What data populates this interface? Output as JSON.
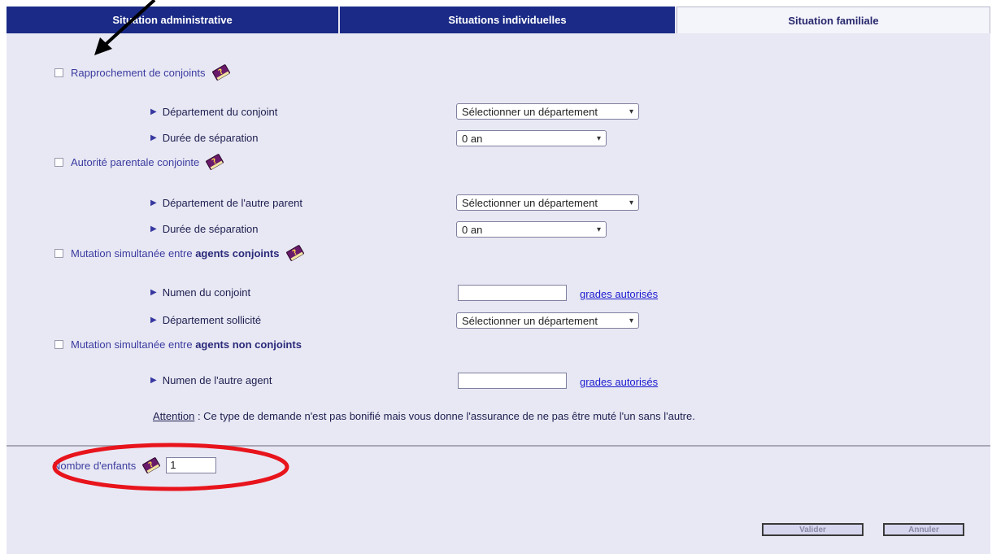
{
  "tabs": [
    "Situation administrative",
    "Situations individuelles",
    "Situation familiale"
  ],
  "sections": {
    "rapprochement": {
      "label": "Rapprochement de conjoints",
      "dept_label": "Département du conjoint",
      "dept_value": "Sélectionner un département",
      "duree_label": "Durée de séparation",
      "duree_value": "0 an"
    },
    "autorite": {
      "label": "Autorité parentale conjointe",
      "dept_label": "Département de l'autre parent",
      "dept_value": "Sélectionner un département",
      "duree_label": "Durée de séparation",
      "duree_value": "0 an"
    },
    "mutation_conjoints": {
      "label_prefix": "Mutation simultanée entre ",
      "label_bold": "agents conjoints",
      "numen_label": "Numen du conjoint",
      "numen_value": "",
      "grades_link": "grades autorisés",
      "dept_label": "Département sollicité",
      "dept_value": "Sélectionner un département"
    },
    "mutation_non_conjoints": {
      "label_prefix": "Mutation simultanée entre ",
      "label_bold": "agents non conjoints",
      "numen_label": "Numen de l'autre agent",
      "numen_value": "",
      "grades_link": "grades autorisés"
    }
  },
  "note": {
    "title": "Attention",
    "text": " : Ce type de demande n'est pas bonifié mais vous donne l'assurance de ne pas être muté l'un sans l'autre."
  },
  "enfants": {
    "label": "Nombre d'enfants",
    "value": "1"
  },
  "buttons": {
    "validate": "Valider",
    "cancel": "Annuler"
  },
  "colors": {
    "tab_dark": "#1a2a86",
    "page_bg": "#e8e8f4",
    "annotation_red": "#e8141c",
    "link": "#1a1ad0"
  }
}
